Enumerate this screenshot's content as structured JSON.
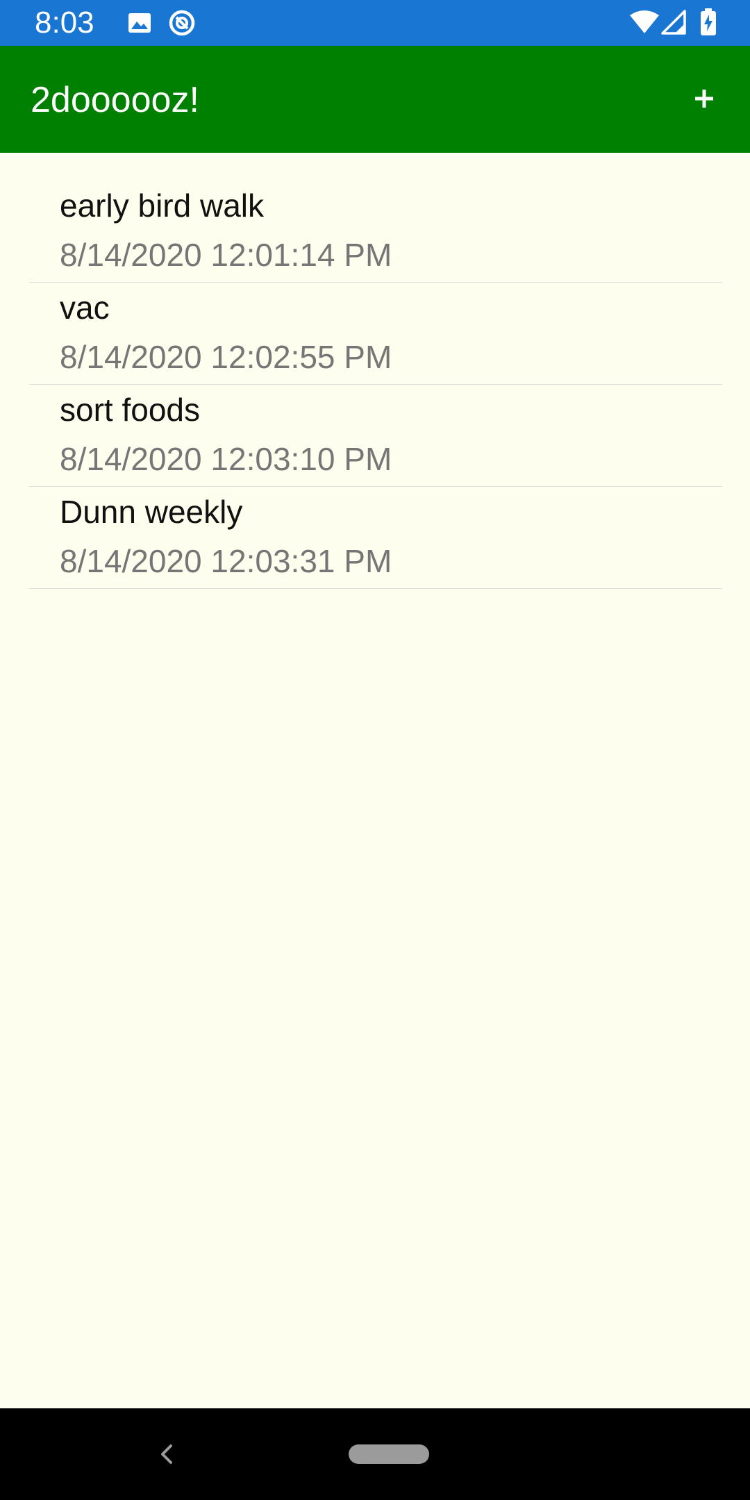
{
  "status_bar": {
    "time": "8:03",
    "icons": [
      "image-icon",
      "vpn-icon",
      "wifi-icon",
      "cell-signal-icon",
      "battery-charging-icon"
    ],
    "background_color": "#1976d2"
  },
  "app_bar": {
    "title": "2doooooz!",
    "add_label": "+",
    "background_color": "#008000"
  },
  "todos": [
    {
      "title": "early bird walk",
      "timestamp": "8/14/2020 12:01:14 PM"
    },
    {
      "title": "vac",
      "timestamp": "8/14/2020 12:02:55 PM"
    },
    {
      "title": "sort foods",
      "timestamp": "8/14/2020 12:03:10 PM"
    },
    {
      "title": "Dunn weekly",
      "timestamp": "8/14/2020 12:03:31 PM"
    }
  ],
  "nav_bar": {
    "icons": [
      "back-icon",
      "home-pill-icon"
    ]
  },
  "colors": {
    "page_background": "#fefeee",
    "secondary_text": "#767676"
  }
}
